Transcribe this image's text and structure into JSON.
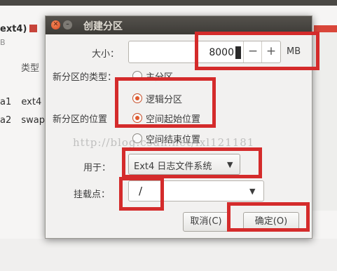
{
  "background": {
    "header": "ext4)",
    "subheader": "B",
    "column_type": "类型",
    "rows": [
      {
        "device": "a1",
        "type": "ext4"
      },
      {
        "device": "a2",
        "type": "swap"
      }
    ]
  },
  "dialog": {
    "title": "创建分区",
    "size_label": "大小：",
    "size_value": "8000",
    "size_unit": "MB",
    "minus": "−",
    "plus": "+",
    "type_label": "新分区的类型：",
    "type_options": [
      {
        "label": "主分区",
        "selected": false
      },
      {
        "label": "逻辑分区",
        "selected": true
      }
    ],
    "location_label": "新分区的位置",
    "location_options": [
      {
        "label": "空间起始位置",
        "selected": true
      },
      {
        "label": "空间结束位置",
        "selected": false
      }
    ],
    "use_as_label": "用于：",
    "use_as_value": "Ext4 日志文件系统",
    "mount_label": "挂载点：",
    "mount_value": "/",
    "cancel": "取消(C)",
    "ok": "确定(O)"
  },
  "watermark": "http://blog.csdn.net/lxl121181",
  "colors": {
    "annotation": "#d42b2b",
    "radio_accent": "#e05a2f",
    "titlebar": "#3d3b37"
  }
}
